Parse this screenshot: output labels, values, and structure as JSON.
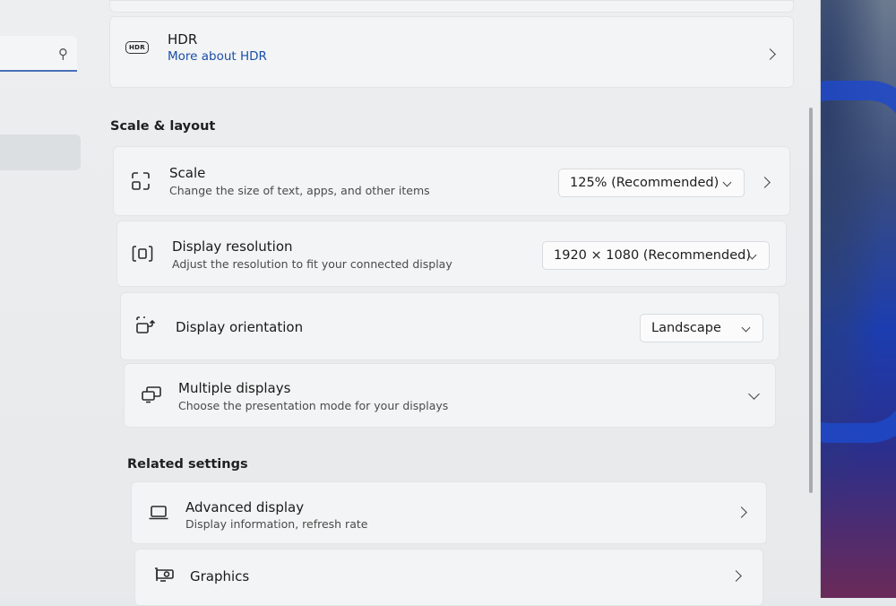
{
  "search": {
    "icon": "search-icon"
  },
  "hdr": {
    "title": "HDR",
    "link": "More about HDR",
    "badge": "HDR"
  },
  "sections": {
    "scale_layout": "Scale & layout",
    "related": "Related settings"
  },
  "scale": {
    "title": "Scale",
    "subtitle": "Change the size of text, apps, and other items",
    "value": "125% (Recommended)"
  },
  "resolution": {
    "title": "Display resolution",
    "subtitle": "Adjust the resolution to fit your connected display",
    "value": "1920 × 1080 (Recommended)"
  },
  "orientation": {
    "title": "Display orientation",
    "value": "Landscape"
  },
  "multiple": {
    "title": "Multiple displays",
    "subtitle": "Choose the presentation mode for your displays"
  },
  "advanced": {
    "title": "Advanced display",
    "subtitle": "Display information, refresh rate"
  },
  "graphics": {
    "title": "Graphics"
  },
  "colors": {
    "accent": "#1a4fa8",
    "card": "#f3f4f5",
    "background": "#e7e9eb"
  }
}
